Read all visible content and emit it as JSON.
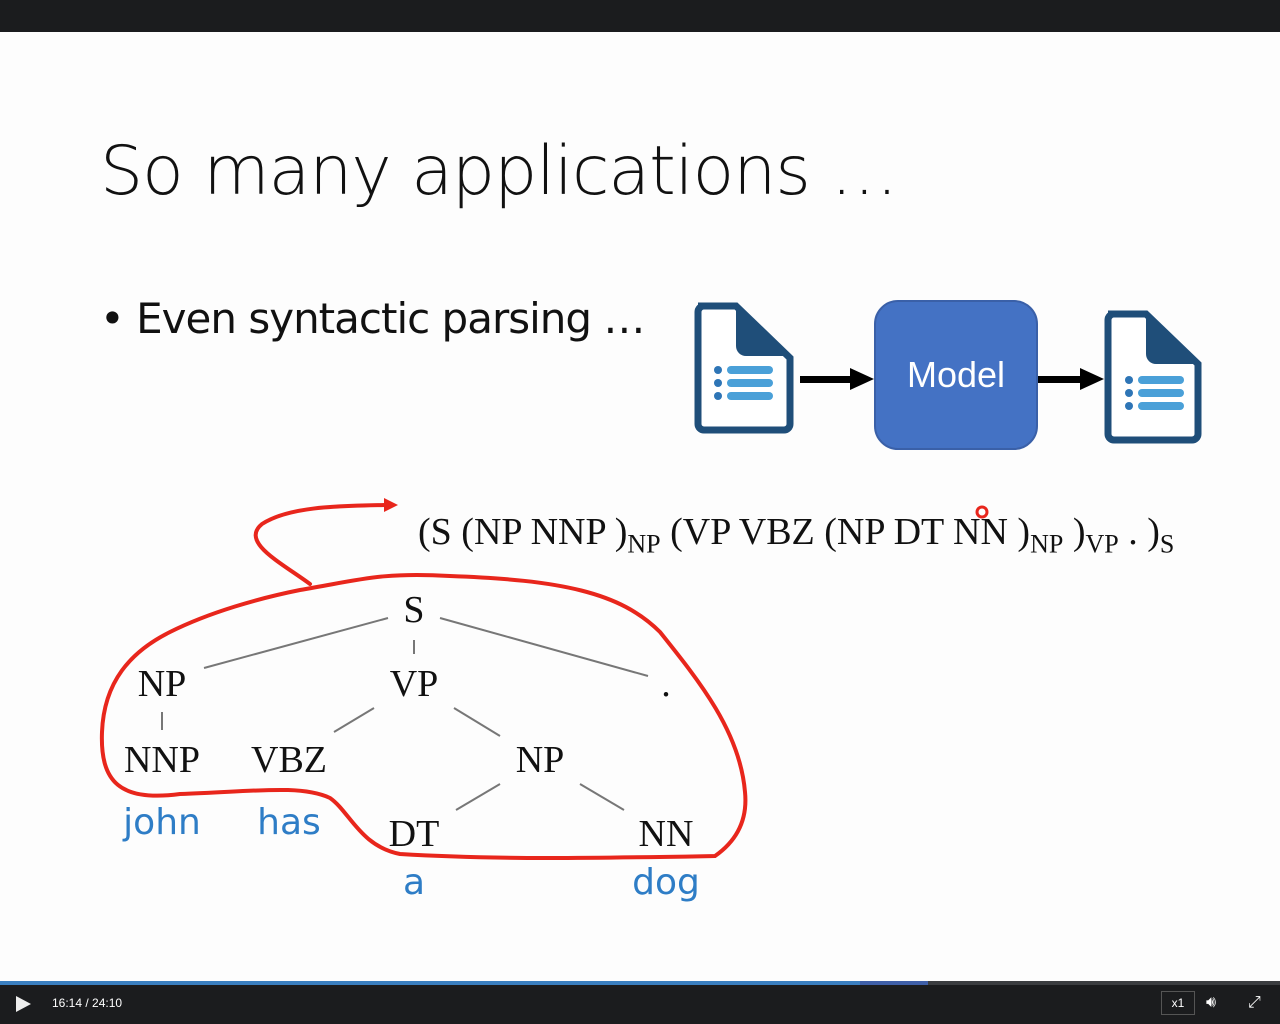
{
  "slide": {
    "title": "So many applications …",
    "bullet": "• Even syntactic parsing …",
    "model_label": "Model",
    "formula": {
      "parts": [
        "(S (NP NNP )",
        "NP",
        " (VP VBZ (NP DT NN )",
        "NP",
        " )",
        "VP",
        " . )",
        "S"
      ]
    },
    "tree": {
      "nodes": [
        "S",
        "NP",
        "VP",
        ".",
        "NNP",
        "VBZ",
        "NP",
        "DT",
        "NN"
      ],
      "words": [
        "john",
        "has",
        "a",
        "dog"
      ]
    }
  },
  "player": {
    "time": "16:14 / 24:10",
    "progress_fraction": 0.672,
    "buffered_fraction": 0.725,
    "speed": "x1",
    "colors": {
      "played": "#3a7fc0",
      "buffered": "#3f5fa8",
      "annotation": "#e8261c"
    }
  }
}
